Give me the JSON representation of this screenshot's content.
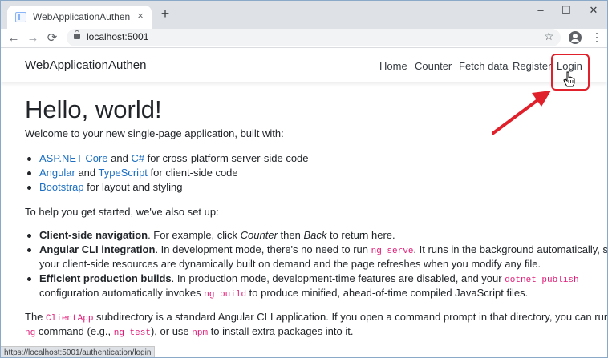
{
  "browser": {
    "tab_title": "WebApplicationAuthen",
    "tab_close": "×",
    "new_tab": "+",
    "window_controls": {
      "minimize": "–",
      "maximize": "☐",
      "close": "✕"
    },
    "nav": {
      "back": "←",
      "forward": "→",
      "reload": "⟳"
    },
    "url": "localhost:5001",
    "star": "☆",
    "menu": "⋮",
    "status_url": "https://localhost:5001/authentication/login"
  },
  "app": {
    "brand": "WebApplicationAuthen",
    "nav": {
      "home": "Home",
      "counter": "Counter",
      "fetch": "Fetch data",
      "register": "Register",
      "login": "Login"
    }
  },
  "content": {
    "heading": "Hello, world!",
    "intro": "Welcome to your new single-page application, built with:",
    "built_with": [
      {
        "link1": "ASP.NET Core",
        "mid": " and ",
        "link2": "C#",
        "rest": " for cross-platform server-side code"
      },
      {
        "link1": "Angular",
        "mid": " and ",
        "link2": "TypeScript",
        "rest": " for client-side code"
      },
      {
        "link1": "Bootstrap",
        "rest": " for layout and styling"
      }
    ],
    "setup_intro": "To help you get started, we've also set up:",
    "setup": {
      "nav_bold": "Client-side navigation",
      "nav_text1": ". For example, click ",
      "nav_em1": "Counter",
      "nav_text2": " then ",
      "nav_em2": "Back",
      "nav_text3": " to return here.",
      "cli_bold": "Angular CLI integration",
      "cli_text1": ". In development mode, there's no need to run ",
      "cli_code": "ng serve",
      "cli_text2": ". It runs in the background automatically, so",
      "cli_line2": "your client-side resources are dynamically built on demand and the page refreshes when you modify any file.",
      "prod_bold": "Efficient production builds",
      "prod_text1": ". In production mode, development-time features are disabled, and your ",
      "prod_code": "dotnet publish",
      "prod_line2a": "configuration automatically invokes ",
      "prod_code2": "ng build",
      "prod_line2b": " to produce minified, ahead-of-time compiled JavaScript files."
    },
    "footer": {
      "t1": "The ",
      "c1": "ClientApp",
      "t2": " subdirectory is a standard Angular CLI application. If you open a command prompt in that directory, you can run any",
      "c2": "ng",
      "t3": " command (e.g., ",
      "c3": "ng test",
      "t4": "), or use ",
      "c4": "npm",
      "t5": " to install extra packages into it."
    }
  },
  "colors": {
    "link": "#1b6ec2",
    "code": "#e01a76",
    "annotation": "#e0202a"
  }
}
